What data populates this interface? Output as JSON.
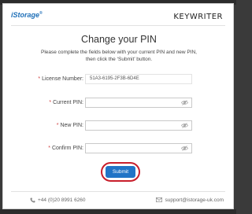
{
  "header": {
    "brand": "iStorage",
    "brand_mark": "®",
    "product": "KEYWRITER"
  },
  "main": {
    "title": "Change your PIN",
    "instructions_line1": "Please complete the fields below with your current PIN and new PIN,",
    "instructions_line2": "then click the ‘Submit’ button.",
    "required_mark": "*",
    "fields": {
      "license": {
        "label": "License Number:",
        "value": "51A3-6195-2F3B-6D4E"
      },
      "current_pin": {
        "label": "Current PIN:",
        "value": ""
      },
      "new_pin": {
        "label": "New PIN:",
        "value": ""
      },
      "confirm_pin": {
        "label": "Confirm PIN:",
        "value": ""
      }
    },
    "submit_label": "Submit"
  },
  "footer": {
    "phone": "+44 (0)20 8991 6260",
    "email": "support@istorage-uk.com"
  },
  "colors": {
    "accent": "#2174c6",
    "highlight_ring": "#c81e2b",
    "brand": "#1e6fb8"
  }
}
